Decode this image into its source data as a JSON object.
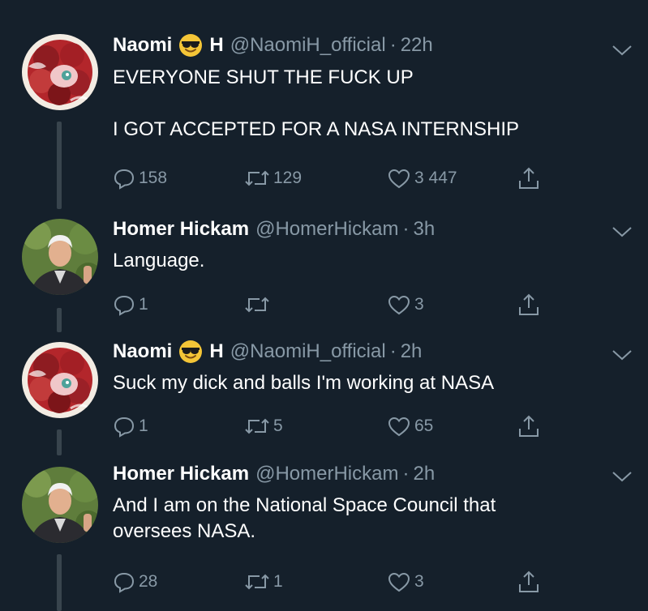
{
  "colors": {
    "background": "#15202b",
    "text_primary": "#ffffff",
    "text_secondary": "#8899a6",
    "thread_line": "#38444d"
  },
  "tweets": [
    {
      "name_first": "Naomi",
      "name_emoji": "smiling-face-with-sunglasses",
      "name_last": "H",
      "handle": "@NaomiH_official",
      "dot": "·",
      "time": "22h",
      "text": "EVERYONE SHUT THE FUCK UP\n\nI GOT ACCEPTED FOR A NASA INTERNSHIP",
      "replies": "158",
      "retweets": "129",
      "likes": "3 447",
      "avatar_icon": "anime-avatar"
    },
    {
      "name": "Homer Hickam",
      "handle": "@HomerHickam",
      "dot": "·",
      "time": "3h",
      "text": "Language.",
      "replies": "1",
      "retweets": "",
      "likes": "3",
      "avatar_icon": "profile-photo"
    },
    {
      "name_first": "Naomi",
      "name_emoji": "smiling-face-with-sunglasses",
      "name_last": "H",
      "handle": "@NaomiH_official",
      "dot": "·",
      "time": "2h",
      "text": "Suck my dick and balls I'm working at NASA",
      "replies": "1",
      "retweets": "5",
      "likes": "65",
      "avatar_icon": "anime-avatar"
    },
    {
      "name": "Homer Hickam",
      "handle": "@HomerHickam",
      "dot": "·",
      "time": "2h",
      "text": "And I am on the National Space Council that\noversees NASA.",
      "replies": "28",
      "retweets": "1",
      "likes": "3",
      "avatar_icon": "profile-photo"
    }
  ]
}
